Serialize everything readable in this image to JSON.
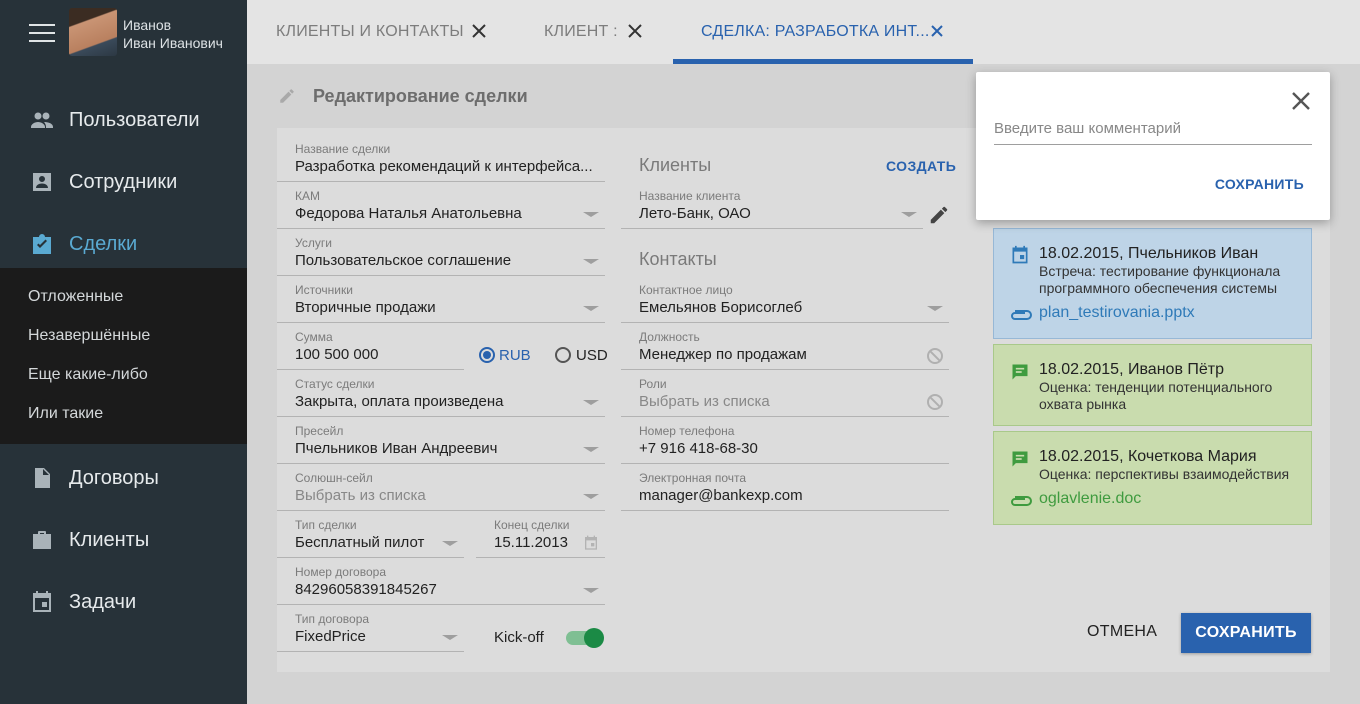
{
  "user": {
    "last_name": "Иванов",
    "first_names": "Иван Иванович"
  },
  "nav": {
    "items": [
      {
        "label": "Пользователи",
        "icon": "people-icon"
      },
      {
        "label": "Сотрудники",
        "icon": "account-box-icon"
      },
      {
        "label": "Сделки",
        "icon": "assignment-check-icon",
        "active": true
      },
      {
        "label": "Договоры",
        "icon": "document-icon"
      },
      {
        "label": "Клиенты",
        "icon": "briefcase-icon"
      },
      {
        "label": "Задачи",
        "icon": "calendar-icon"
      }
    ],
    "submenu": [
      "Отложенные",
      "Незавершённые",
      "Еще какие-либо",
      "Или такие"
    ]
  },
  "tabs": [
    {
      "label": "КЛИЕНТЫ И КОНТАКТЫ"
    },
    {
      "label": "КЛИЕНТ :"
    },
    {
      "label": "СДЕЛКА: РАЗРАБОТКА ИНТ...",
      "active": true
    }
  ],
  "page": {
    "title": "Редактирование сделки"
  },
  "form": {
    "deal_name": {
      "label": "Название сделки",
      "value": "Разработка рекомендаций к интерфейса..."
    },
    "kam": {
      "label": "КАМ",
      "value": "Федорова Наталья Анатольевна"
    },
    "services": {
      "label": "Услуги",
      "value": "Пользовательское соглашение"
    },
    "sources": {
      "label": "Источники",
      "value": "Вторичные продажи"
    },
    "amount": {
      "label": "Сумма",
      "value": "100 500 000"
    },
    "currency": {
      "options": [
        "RUB",
        "USD"
      ],
      "selected": "RUB"
    },
    "status": {
      "label": "Статус сделки",
      "value": "Закрыта, оплата произведена"
    },
    "presale": {
      "label": "Пресейл",
      "value": "Пчельников Иван Андреевич"
    },
    "solution_sale": {
      "label": "Солюшн-сейл",
      "placeholder": "Выбрать из списка"
    },
    "deal_type": {
      "label": "Тип сделки",
      "value": "Бесплатный пилот"
    },
    "deal_end": {
      "label": "Конец сделки",
      "value": "15.11.2013"
    },
    "contract_number": {
      "label": "Номер договора",
      "value": "84296058391845267"
    },
    "contract_type": {
      "label": "Тип договора",
      "value": "FixedPrice"
    },
    "kickoff": {
      "label": "Kick-off",
      "on": true
    }
  },
  "clients": {
    "title": "Клиенты",
    "create_label": "СОЗДАТЬ",
    "client_name": {
      "label": "Название клиента",
      "value": "Лето-Банк, ОАО"
    }
  },
  "contacts": {
    "title": "Контакты",
    "contact": {
      "label": "Контактное лицо",
      "value": "Емельянов Борисоглеб"
    },
    "position": {
      "label": "Должность",
      "value": "Менеджер по продажам"
    },
    "roles": {
      "label": "Роли",
      "placeholder": "Выбрать из списка"
    },
    "phone": {
      "label": "Номер телефона",
      "value": "+7 916 418-68-30"
    },
    "email": {
      "label": "Электронная почта",
      "value": "manager@bankexp.com"
    }
  },
  "comments": [
    {
      "date": "18.02.2015,",
      "author": "Пчельников Иван",
      "text": "Встреча: тестирование функционала программного обеспечения системы",
      "attachment": "plan_testirovania.pptx",
      "icon": "event-icon",
      "color": "#bed4e7"
    },
    {
      "date": "18.02.2015,",
      "author": "Иванов Пётр",
      "text": "Оценка: тенденции потенциального охвата рынка",
      "icon": "comment-icon",
      "color": "#c9dcae"
    },
    {
      "date": "18.02.2015,",
      "author": "Кочеткова Мария",
      "text": "Оценка: перспективы взаимодействия",
      "attachment": "oglavlenie.doc",
      "icon": "comment-icon",
      "color": "#c9dcae"
    }
  ],
  "actions": {
    "cancel_label": "ОТМЕНА",
    "save_label": "СОХРАНИТЬ"
  },
  "popup": {
    "placeholder": "Введите ваш комментарий",
    "save_label": "СОХРАНИТЬ"
  },
  "colors": {
    "accent": "#2962ae",
    "sidebar": "#273239",
    "active_nav": "#5aaad2",
    "toggle": "#1b8a45"
  }
}
